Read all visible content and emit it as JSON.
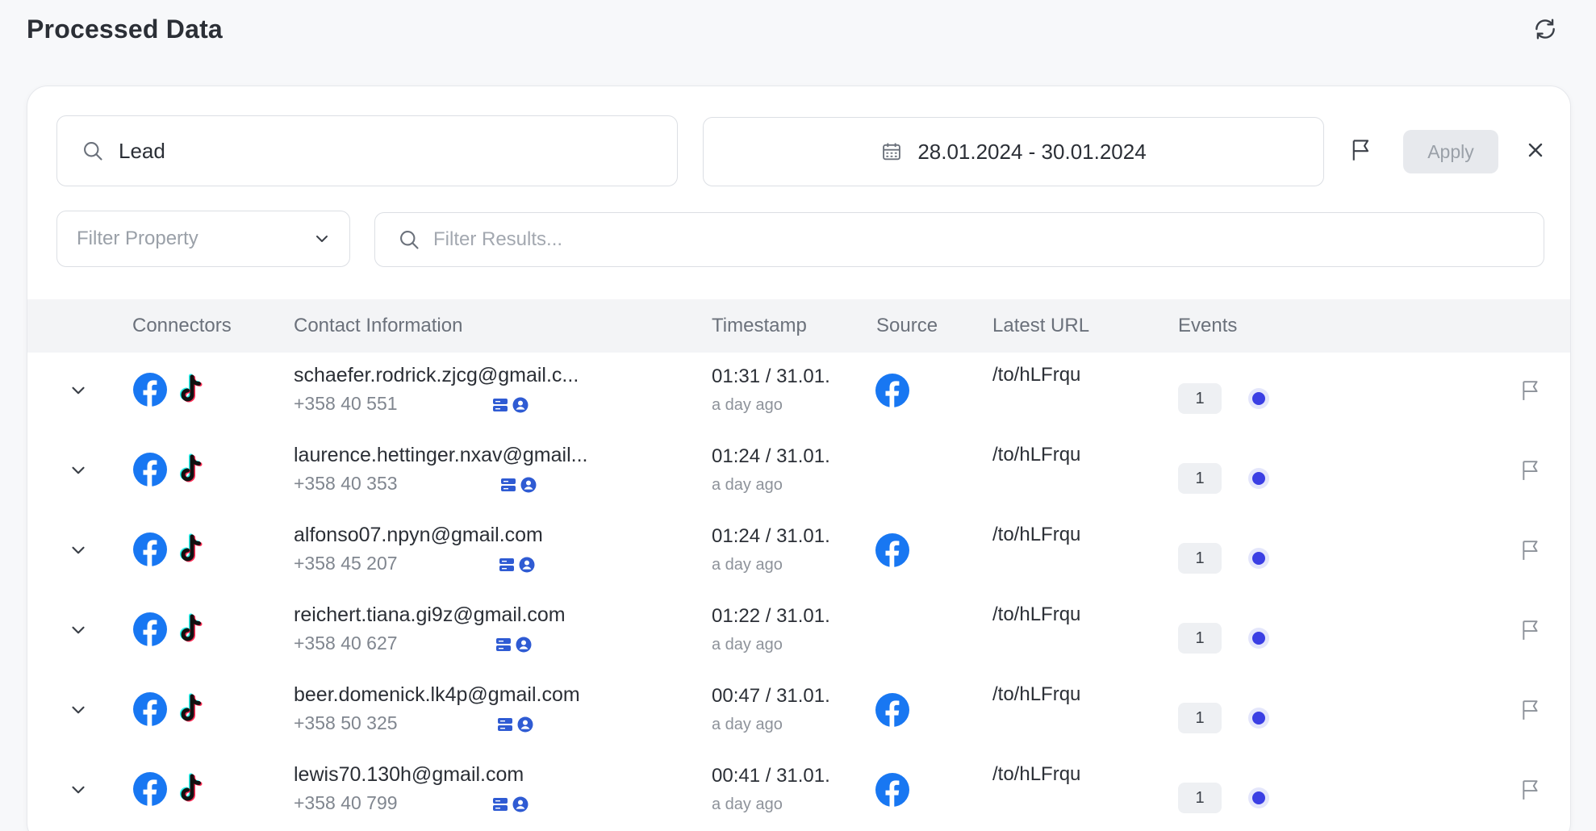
{
  "header": {
    "title": "Processed Data"
  },
  "filters": {
    "search_value": "Lead",
    "date_range": "28.01.2024 - 30.01.2024",
    "apply_label": "Apply",
    "filter_property_placeholder": "Filter Property",
    "filter_results_placeholder": "Filter Results..."
  },
  "table": {
    "columns": [
      "Connectors",
      "Contact Information",
      "Timestamp",
      "Source",
      "Latest URL",
      "Events"
    ],
    "rows": [
      {
        "email": "schaefer.rodrick.zjcg@gmail.c...",
        "phone": "+358 40 551",
        "time": "01:31 / 31.01.",
        "ago": "a day ago",
        "source": "facebook",
        "url": "/to/hLFrqu",
        "events": "1"
      },
      {
        "email": "laurence.hettinger.nxav@gmail...",
        "phone": "+358 40 353",
        "time": "01:24 / 31.01.",
        "ago": "a day ago",
        "source": "",
        "url": "/to/hLFrqu",
        "events": "1"
      },
      {
        "email": "alfonso07.npyn@gmail.com",
        "phone": "+358 45 207",
        "time": "01:24 / 31.01.",
        "ago": "a day ago",
        "source": "facebook",
        "url": "/to/hLFrqu",
        "events": "1"
      },
      {
        "email": "reichert.tiana.gi9z@gmail.com",
        "phone": "+358 40 627",
        "time": "01:22 / 31.01.",
        "ago": "a day ago",
        "source": "",
        "url": "/to/hLFrqu",
        "events": "1"
      },
      {
        "email": "beer.domenick.lk4p@gmail.com",
        "phone": "+358 50 325",
        "time": "00:47 / 31.01.",
        "ago": "a day ago",
        "source": "facebook",
        "url": "/to/hLFrqu",
        "events": "1"
      },
      {
        "email": "lewis70.130h@gmail.com",
        "phone": "+358 40 799",
        "time": "00:41 / 31.01.",
        "ago": "a day ago",
        "source": "facebook",
        "url": "/to/hLFrqu",
        "events": "1"
      }
    ]
  },
  "icons": {
    "connectors": [
      "facebook-icon",
      "tiktok-icon"
    ],
    "contact_badges": [
      "server-icon",
      "user-circle-icon"
    ]
  },
  "colors": {
    "facebook": "#1877f2",
    "accent": "#3b3fe4",
    "badge_blue": "#2f5bd3"
  }
}
